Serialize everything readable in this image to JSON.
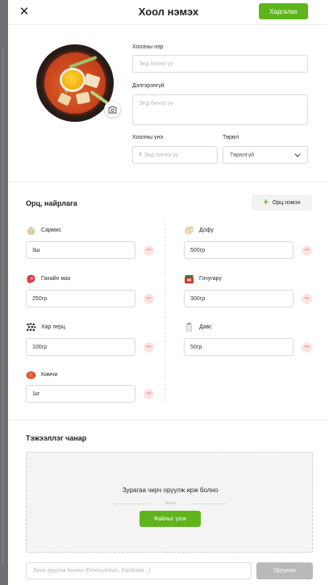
{
  "header": {
    "close_icon": "close-icon",
    "close_glyph": "✕",
    "title": "Хоол нэмэх",
    "save_label": "Хадгалах",
    "accent_color": "#5eb51b"
  },
  "photo": {
    "camera_icon": "camera-icon"
  },
  "form": {
    "name_label": "Хоолны нэр",
    "name_placeholder": "Энд бичнэ үү",
    "description_label": "Дэлгэрэнгүй",
    "description_placeholder": "Энд бичнэ үү",
    "price_label": "Хоолны үнэ",
    "price_placeholder": "₮ Энд бичнэ үү",
    "type_label": "Төрөл",
    "type_value": "Төрөлгүй",
    "type_icon": "chevron-down-icon"
  },
  "ingredients": {
    "title": "Орц, найрлага",
    "add_label": "Орц нэмэх",
    "remove_glyph": "−",
    "items": [
      {
        "name": "Сармис",
        "value": "3ш",
        "icon": "garlic-icon"
      },
      {
        "name": "Дофу",
        "value": "500гр",
        "icon": "tofu-icon"
      },
      {
        "name": "Гахайн мах",
        "value": "250гр",
        "icon": "meat-icon"
      },
      {
        "name": "Гочугару",
        "value": "300гр",
        "icon": "chili-powder-icon"
      },
      {
        "name": "Хар перц",
        "value": "100гр",
        "icon": "pepper-icon"
      },
      {
        "name": "Давс",
        "value": "50гр",
        "icon": "salt-icon"
      },
      {
        "name": "Кимчи",
        "value": "1кг",
        "icon": "kimchi-icon"
      }
    ]
  },
  "nutrition": {
    "title": "Тэжээллэг чанар",
    "drop_text": "Зурагаа чирч оруулж ирж болно",
    "or_text": "Эсвэл",
    "browse_label": "Файлыг үзэх",
    "link_placeholder": "Линк оруулж болно (Freenutrition, Fastfood...)",
    "submit_label": "Оруулах"
  }
}
